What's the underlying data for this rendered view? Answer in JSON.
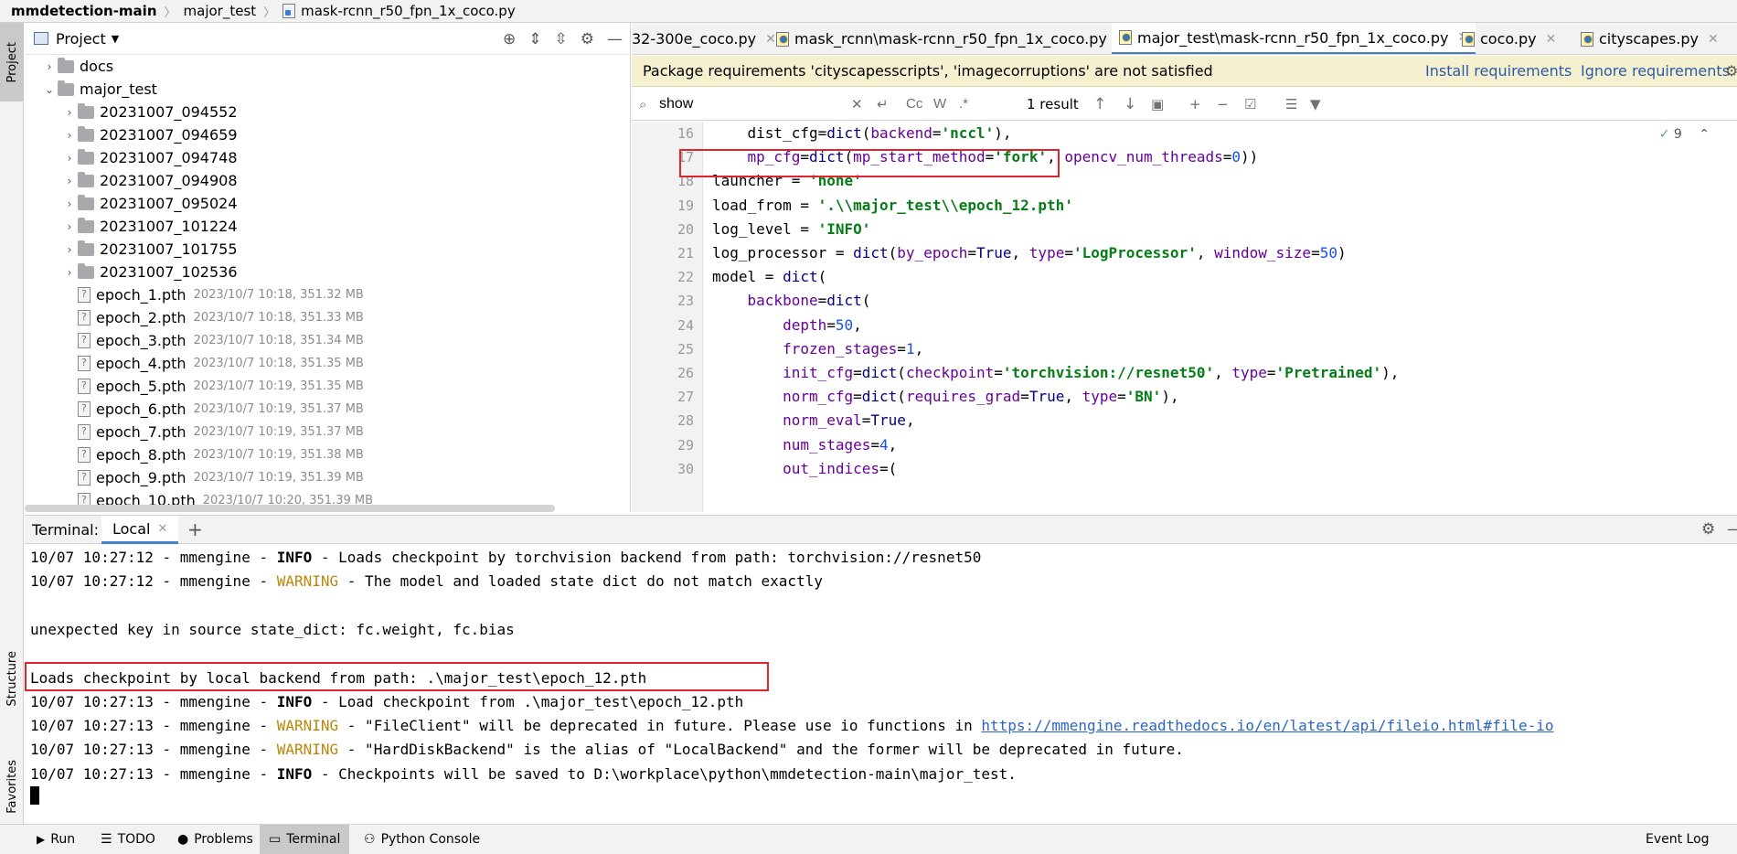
{
  "breadcrumb": {
    "project": "mmdetection-main",
    "folder": "major_test",
    "file": "mask-rcnn_r50_fpn_1x_coco.py"
  },
  "stripe": {
    "project": "Project",
    "structure": "Structure",
    "favorites": "Favorites"
  },
  "project_panel": {
    "title": "Project",
    "tree": [
      {
        "type": "folder",
        "name": "docs",
        "expanded": false,
        "indent": 1,
        "meta": ""
      },
      {
        "type": "folder",
        "name": "major_test",
        "expanded": true,
        "indent": 1,
        "meta": ""
      },
      {
        "type": "folder",
        "name": "20231007_094552",
        "expanded": false,
        "indent": 2,
        "meta": ""
      },
      {
        "type": "folder",
        "name": "20231007_094659",
        "expanded": false,
        "indent": 2,
        "meta": ""
      },
      {
        "type": "folder",
        "name": "20231007_094748",
        "expanded": false,
        "indent": 2,
        "meta": ""
      },
      {
        "type": "folder",
        "name": "20231007_094908",
        "expanded": false,
        "indent": 2,
        "meta": ""
      },
      {
        "type": "folder",
        "name": "20231007_095024",
        "expanded": false,
        "indent": 2,
        "meta": ""
      },
      {
        "type": "folder",
        "name": "20231007_101224",
        "expanded": false,
        "indent": 2,
        "meta": ""
      },
      {
        "type": "folder",
        "name": "20231007_101755",
        "expanded": false,
        "indent": 2,
        "meta": ""
      },
      {
        "type": "folder",
        "name": "20231007_102536",
        "expanded": false,
        "indent": 2,
        "meta": ""
      },
      {
        "type": "file",
        "name": "epoch_1.pth",
        "indent": 2,
        "meta": "2023/10/7 10:18, 351.32 MB"
      },
      {
        "type": "file",
        "name": "epoch_2.pth",
        "indent": 2,
        "meta": "2023/10/7 10:18, 351.33 MB"
      },
      {
        "type": "file",
        "name": "epoch_3.pth",
        "indent": 2,
        "meta": "2023/10/7 10:18, 351.34 MB"
      },
      {
        "type": "file",
        "name": "epoch_4.pth",
        "indent": 2,
        "meta": "2023/10/7 10:18, 351.35 MB"
      },
      {
        "type": "file",
        "name": "epoch_5.pth",
        "indent": 2,
        "meta": "2023/10/7 10:19, 351.35 MB"
      },
      {
        "type": "file",
        "name": "epoch_6.pth",
        "indent": 2,
        "meta": "2023/10/7 10:19, 351.37 MB"
      },
      {
        "type": "file",
        "name": "epoch_7.pth",
        "indent": 2,
        "meta": "2023/10/7 10:19, 351.37 MB"
      },
      {
        "type": "file",
        "name": "epoch_8.pth",
        "indent": 2,
        "meta": "2023/10/7 10:19, 351.38 MB"
      },
      {
        "type": "file",
        "name": "epoch_9.pth",
        "indent": 2,
        "meta": "2023/10/7 10:19, 351.39 MB"
      },
      {
        "type": "file",
        "name": "epoch_10.pth",
        "indent": 2,
        "meta": "2023/10/7 10:20, 351.39 MB"
      }
    ]
  },
  "editor_tabs": [
    {
      "label": "32-300e_coco.py",
      "active": false
    },
    {
      "label": "mask_rcnn\\mask-rcnn_r50_fpn_1x_coco.py",
      "active": false
    },
    {
      "label": "major_test\\mask-rcnn_r50_fpn_1x_coco.py",
      "active": true
    },
    {
      "label": "coco.py",
      "active": false
    },
    {
      "label": "cityscapes.py",
      "active": false
    }
  ],
  "banner": {
    "message": "Package requirements 'cityscapesscripts', 'imagecorruptions' are not satisfied",
    "install": "Install requirements",
    "ignore": "Ignore requirements"
  },
  "find": {
    "query": "show",
    "result": "1 result",
    "match_case": "Cc",
    "words": "W",
    "regex": ".*"
  },
  "inspection": {
    "count": "9"
  },
  "code_lines": [
    {
      "n": "16",
      "html": "    dist_cfg=<span class=\"b\">dict</span>(<span class=\"k\">backend</span>=<span class=\"s\">'nccl'</span>),"
    },
    {
      "n": "17",
      "html": "    <span class=\"k\">mp_cfg</span>=<span class=\"b\">dict</span>(<span class=\"k\">mp_start_method</span>=<span class=\"s\">'fork'</span>, <span class=\"k\">opencv_num_threads</span>=<span class=\"n\">0</span>))"
    },
    {
      "n": "18",
      "html": "launcher = <span class=\"s\">'none'</span>"
    },
    {
      "n": "19",
      "html": "load_from = <span class=\"s\">'.\\\\major_test\\\\epoch_12.pth'</span>"
    },
    {
      "n": "20",
      "html": "log_level = <span class=\"s\">'INFO'</span>"
    },
    {
      "n": "21",
      "html": "log_processor = <span class=\"b\">dict</span>(<span class=\"k\">by_epoch</span>=<span class=\"b\">True</span>, <span class=\"k\">type</span>=<span class=\"s\">'LogProcessor'</span>, <span class=\"k\">window_size</span>=<span class=\"n\">50</span>)"
    },
    {
      "n": "22",
      "html": "model = <span class=\"b\">dict</span>("
    },
    {
      "n": "23",
      "html": "    <span class=\"k\">backbone</span>=<span class=\"b\">dict</span>("
    },
    {
      "n": "24",
      "html": "        <span class=\"k\">depth</span>=<span class=\"n\">50</span>,"
    },
    {
      "n": "25",
      "html": "        <span class=\"k\">frozen_stages</span>=<span class=\"n\">1</span>,"
    },
    {
      "n": "26",
      "html": "        <span class=\"k\">init_cfg</span>=<span class=\"b\">dict</span>(<span class=\"k\">checkpoint</span>=<span class=\"s\">'torchvision://resnet50'</span>, <span class=\"k\">type</span>=<span class=\"s\">'Pretrained'</span>),"
    },
    {
      "n": "27",
      "html": "        <span class=\"k\">norm_cfg</span>=<span class=\"b\">dict</span>(<span class=\"k\">requires_grad</span>=<span class=\"b\">True</span>, <span class=\"k\">type</span>=<span class=\"s\">'BN'</span>),"
    },
    {
      "n": "28",
      "html": "        <span class=\"k\">norm_eval</span>=<span class=\"b\">True</span>,"
    },
    {
      "n": "29",
      "html": "        <span class=\"k\">num_stages</span>=<span class=\"n\">4</span>,"
    },
    {
      "n": "30",
      "html": "        <span class=\"k\">out_indices</span>=("
    }
  ],
  "terminal": {
    "label": "Terminal:",
    "tab": "Local",
    "lines": [
      {
        "html": "10/07 10:27:12 - mmengine - <span class=\"info\">INFO</span> - Loads checkpoint by torchvision backend from path: torchvision://resnet50"
      },
      {
        "html": "10/07 10:27:12 - mmengine - <span class=\"warn\">WARNING</span> - The model and loaded state dict do not match exactly"
      },
      {
        "html": ""
      },
      {
        "html": "unexpected key in source state_dict: fc.weight, fc.bias"
      },
      {
        "html": ""
      },
      {
        "html": "Loads checkpoint by local backend from path: .\\major_test\\epoch_12.pth"
      },
      {
        "html": "10/07 10:27:13 - mmengine - <span class=\"info\">INFO</span> - Load checkpoint from .\\major_test\\epoch_12.pth"
      },
      {
        "html": "10/07 10:27:13 - mmengine - <span class=\"warn\">WARNING</span> - \"FileClient\" will be deprecated in future. Please use io functions in <a>https://mmengine.readthedocs.io/en/latest/api/fileio.html#file-io</a>"
      },
      {
        "html": "10/07 10:27:13 - mmengine - <span class=\"warn\">WARNING</span> - \"HardDiskBackend\" is the alias of \"LocalBackend\" and the former will be deprecated in future."
      },
      {
        "html": "10/07 10:27:13 - mmengine - <span class=\"info\">INFO</span> - Checkpoints will be saved to D:\\workplace\\python\\mmdetection-main\\major_test."
      }
    ]
  },
  "bottombar": {
    "run": "Run",
    "todo": "TODO",
    "problems": "Problems",
    "terminal": "Terminal",
    "python_console": "Python Console",
    "event_log": "Event Log"
  },
  "colors": {
    "accent": "#4083c9",
    "highlight": "#e0232d",
    "warning": "#b7870a",
    "banner": "#f5f1d0"
  }
}
